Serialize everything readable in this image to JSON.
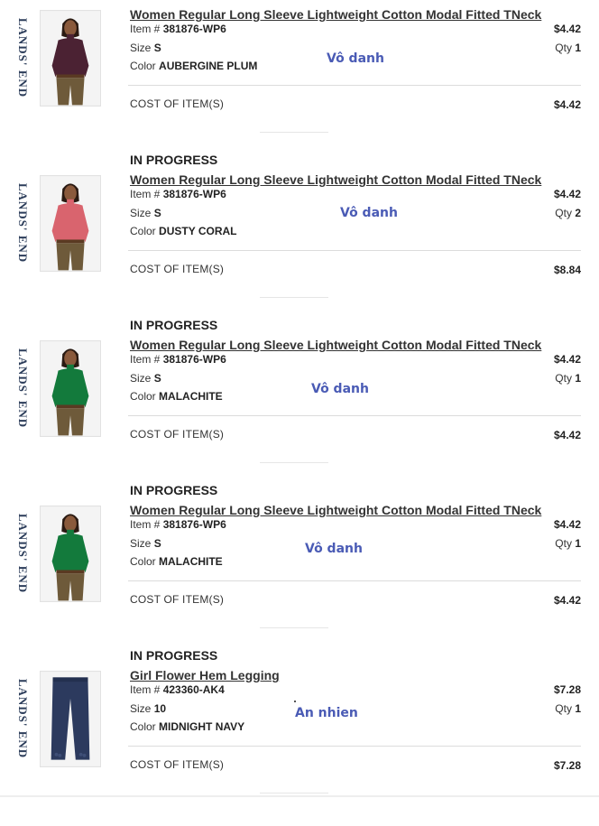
{
  "brand": "LANDS' END",
  "labels": {
    "item": "Item #",
    "size": "Size",
    "color": "Color",
    "qty": "Qty",
    "cost": "COST OF ITEM(S)"
  },
  "items": [
    {
      "status": "",
      "title": "Women Regular Long Sleeve Lightweight Cotton Modal Fitted TNeck",
      "item_no": "381876-WP6",
      "size": "S",
      "color": "AUBERGINE PLUM",
      "price": "$4.42",
      "qty": "1",
      "cost": "$4.42",
      "note": "Vô danh",
      "image": "woman-turtleneck-icon",
      "swatch": "#4b2233"
    },
    {
      "status": "IN PROGRESS",
      "title": "Women Regular Long Sleeve Lightweight Cotton Modal Fitted TNeck",
      "item_no": "381876-WP6",
      "size": "S",
      "color": "DUSTY CORAL",
      "price": "$4.42",
      "qty": "2",
      "cost": "$8.84",
      "note": "Vô danh",
      "image": "woman-turtleneck-icon",
      "swatch": "#d9646e"
    },
    {
      "status": "IN PROGRESS",
      "title": "Women Regular Long Sleeve Lightweight Cotton Modal Fitted TNeck",
      "item_no": "381876-WP6",
      "size": "S",
      "color": "MALACHITE",
      "price": "$4.42",
      "qty": "1",
      "cost": "$4.42",
      "note": "Vô danh",
      "image": "woman-turtleneck-icon",
      "swatch": "#137a3c"
    },
    {
      "status": "IN PROGRESS",
      "title": "Women Regular Long Sleeve Lightweight Cotton Modal Fitted TNeck",
      "item_no": "381876-WP6",
      "size": "S",
      "color": "MALACHITE",
      "price": "$4.42",
      "qty": "1",
      "cost": "$4.42",
      "note": "Vô danh",
      "image": "woman-turtleneck-icon",
      "swatch": "#137a3c"
    },
    {
      "status": "IN PROGRESS",
      "title": "Girl Flower Hem Legging",
      "item_no": "423360-AK4",
      "size": "10",
      "color": "MIDNIGHT NAVY",
      "price": "$7.28",
      "qty": "1",
      "cost": "$7.28",
      "note": "An nhien",
      "image": "legging-icon",
      "swatch": "#2c3a5e"
    }
  ]
}
